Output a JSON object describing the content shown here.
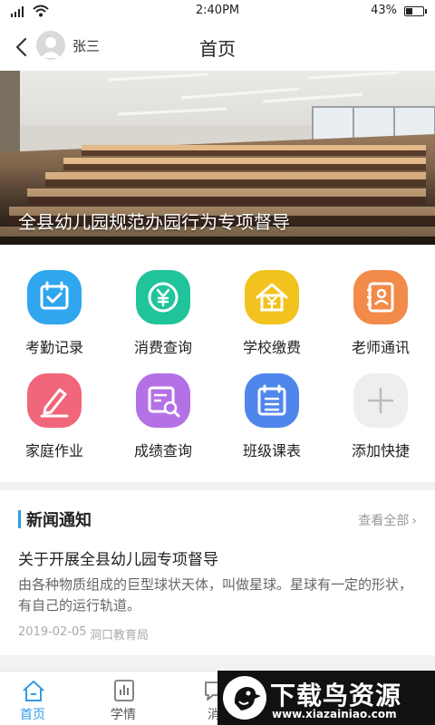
{
  "status_bar": {
    "time": "2:40PM",
    "battery_pct": "43%",
    "battery_level": 0.43
  },
  "nav": {
    "username": "张三",
    "title": "首页"
  },
  "banner": {
    "caption": "全县幼儿园规范办园行为专项督导"
  },
  "grid": {
    "items": [
      {
        "label": "考勤记录",
        "icon": "calendar-check-icon",
        "color": "#2fa6ee"
      },
      {
        "label": "消费查询",
        "icon": "yuan-circle-icon",
        "color": "#21c49a"
      },
      {
        "label": "学校缴费",
        "icon": "yuan-house-icon",
        "color": "#f2c21f"
      },
      {
        "label": "老师通讯",
        "icon": "contacts-book-icon",
        "color": "#f28a4a"
      },
      {
        "label": "家庭作业",
        "icon": "pencil-icon",
        "color": "#f0667a"
      },
      {
        "label": "成绩查询",
        "icon": "report-search-icon",
        "color": "#b471e6"
      },
      {
        "label": "班级课表",
        "icon": "schedule-list-icon",
        "color": "#4f86ec"
      },
      {
        "label": "添加快捷",
        "icon": "plus-icon",
        "color": "#eeeeee"
      }
    ]
  },
  "news": {
    "heading": "新闻通知",
    "more": "查看全部",
    "title": "关于开展全县幼儿园专项督导",
    "desc": "由各种物质组成的巨型球状天体，叫做星球。星球有一定的形状，有自己的运行轨道。",
    "date": "2019-02-05",
    "source": "洞口教育局"
  },
  "tabbar": {
    "tabs": [
      {
        "label": "首页",
        "icon": "home-icon"
      },
      {
        "label": "学情",
        "icon": "bar-chart-icon"
      },
      {
        "label": "消",
        "icon": "message-icon"
      }
    ]
  },
  "watermark": {
    "title": "下载鸟资源",
    "url": "www.xiazainiao.com"
  }
}
